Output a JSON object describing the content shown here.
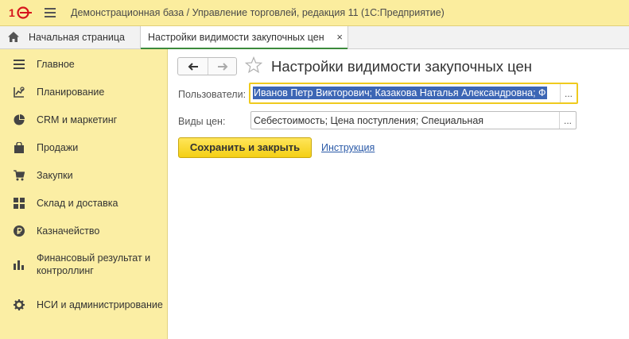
{
  "app": {
    "title": "Демонстрационная база / Управление торговлей, редакция 11  (1С:Предприятие)"
  },
  "colors": {
    "titlebar": "#fbed9e",
    "sidebar": "#fbeea4",
    "accent_green": "#3c8a3c",
    "button_yellow": "#f4cf14",
    "focus_border": "#efca1e",
    "selection": "#3c66b5",
    "link": "#2b5aa8"
  },
  "tabs": {
    "home": {
      "label": "Начальная страница",
      "icon": "home-icon"
    },
    "active": {
      "label": "Настройки видимости закупочных цен",
      "close_glyph": "×"
    }
  },
  "sidebar": {
    "items": [
      {
        "label": "Главное",
        "icon": "menu-lines-icon"
      },
      {
        "label": "Планирование",
        "icon": "planning-icon"
      },
      {
        "label": "CRM и маркетинг",
        "icon": "pie-chart-icon"
      },
      {
        "label": "Продажи",
        "icon": "shopping-bag-icon"
      },
      {
        "label": "Закупки",
        "icon": "cart-icon"
      },
      {
        "label": "Склад и доставка",
        "icon": "warehouse-grid-icon"
      },
      {
        "label": "Казначейство",
        "icon": "ruble-coin-icon"
      },
      {
        "label": "Финансовый результат и контроллинг",
        "icon": "bar-chart-icon"
      },
      {
        "label": "НСИ и администрирование",
        "icon": "gear-icon"
      }
    ]
  },
  "form": {
    "title": "Настройки видимости закупочных цен",
    "users": {
      "label": "Пользователи:",
      "value": "Иванов Петр Викторович; Казакова Наталья Александровна; Ф",
      "button": "..."
    },
    "price_types": {
      "label": "Виды цен:",
      "value": "Себестоимость; Цена поступления; Специальная",
      "button": "..."
    },
    "save_button": "Сохранить и закрыть",
    "help_link": "Инструкция"
  }
}
